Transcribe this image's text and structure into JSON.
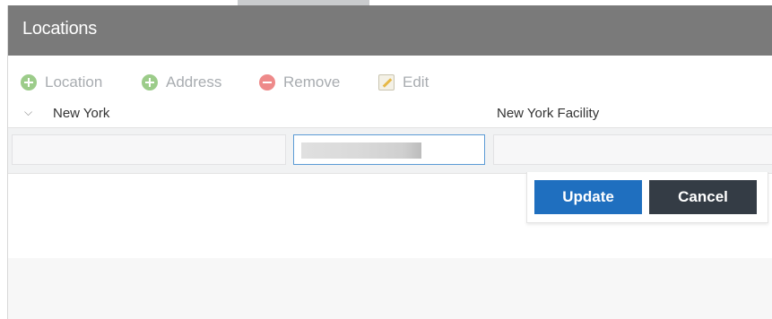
{
  "header": {
    "title": "Locations"
  },
  "toolbar": {
    "location_label": "Location",
    "address_label": "Address",
    "remove_label": "Remove",
    "edit_label": "Edit",
    "icons": {
      "location": "add-circle-icon",
      "address": "add-circle-icon",
      "remove": "remove-circle-icon",
      "edit": "edit-pencil-icon"
    }
  },
  "tree": {
    "node_name": "New York",
    "node_description": "New York Facility",
    "expand_icon": "chevron-down-icon"
  },
  "editor": {
    "name_value": "",
    "description_value": "",
    "update_label": "Update",
    "cancel_label": "Cancel"
  },
  "colors": {
    "header_bg": "#7a7a7a",
    "update_bg": "#1f6fbf",
    "cancel_bg": "#343c45",
    "add_icon": "#9ccc8a",
    "remove_icon": "#ee8a8a"
  }
}
